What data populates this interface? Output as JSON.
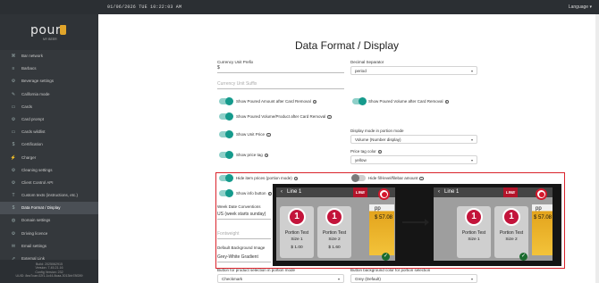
{
  "topbar": {
    "datetime": "01/06/2026 TUE     10:22:03 AM",
    "language": "Language"
  },
  "brand": {
    "name": "pour",
    "tagline": "MY BEER"
  },
  "sidebar": {
    "items": [
      {
        "label": "Bar network",
        "icon": "network-icon"
      },
      {
        "label": "Barbacs",
        "icon": "list-icon"
      },
      {
        "label": "Beverage settings",
        "icon": "gear-icon"
      },
      {
        "label": "California mode",
        "icon": "wrench-icon"
      },
      {
        "label": "Cards",
        "icon": "card-icon"
      },
      {
        "label": "Card prompt",
        "icon": "gear-icon"
      },
      {
        "label": "Cards wildlist",
        "icon": "card-icon"
      },
      {
        "label": "Certification",
        "icon": "dollar-icon"
      },
      {
        "label": "Charger",
        "icon": "plug-icon"
      },
      {
        "label": "Cleaning settings",
        "icon": "gear-icon"
      },
      {
        "label": "Client Control API",
        "icon": "gear-icon"
      },
      {
        "label": "Custom texts (instructions, etc.)",
        "icon": "text-icon"
      },
      {
        "label": "Data Format / Display",
        "icon": "dollar-icon"
      },
      {
        "label": "Domain settings",
        "icon": "globe-icon"
      },
      {
        "label": "Driving licence",
        "icon": "gear-icon"
      },
      {
        "label": "Email settings",
        "icon": "mail-icon"
      },
      {
        "label": "External Link",
        "icon": "link-icon"
      }
    ],
    "active_index": 12,
    "footer": [
      "Build: 2025062915",
      "Version: 7.45.21.16",
      "Config Version: 232",
      "UUID: 8ea7cae-02f1-1c44-8caa-3013bb78f289"
    ]
  },
  "page": {
    "title": "Data Format / Display",
    "currency_prefix_label": "Currency Unit Prefix",
    "currency_prefix_value": "$",
    "currency_suffix_placeholder": "Currency Unit Suffix",
    "decimal_separator_label": "Decimal Separator",
    "decimal_separator_value": "period",
    "display_mode_label": "Display mode in portion mode",
    "display_mode_value": "Volume (Number display)",
    "price_tag_color_label": "Price tag color",
    "price_tag_color_value": "yellow",
    "toggles": [
      "Show Poured Amount after Card Removal",
      "Show Poured Volume after Card Removal",
      "Show Poured Volume/Product after Card Removal",
      "Show Unit Price",
      "Show price tag",
      "Hide item prices (portion mode)",
      "Hide fill-level/filebar amount",
      "Show info button"
    ],
    "week_date_label": "Week Date Conventions",
    "week_date_value": "US (week starts sunday)",
    "unnamed_field_placeholder": "Fontweight",
    "bg_image_label": "Default Background Image",
    "bg_image_value": "Grey-White Gradient",
    "bottom_left_label": "Button for product selection in portion mode",
    "bottom_left_value": "Checkmark",
    "bottom_right_label": "Button background color for portion selection",
    "bottom_right_value": "Grey (Default)"
  },
  "preview": {
    "line_title": "Line 1",
    "logo_text": "LINE",
    "tiles": [
      {
        "number": "1",
        "name": "Portion Test",
        "size": "Size 1",
        "price": "$ 1.00"
      },
      {
        "number": "1",
        "name": "Portion Test",
        "size": "Size 2",
        "price": "$ 1.60"
      }
    ],
    "after_tiles": [
      {
        "number": "1",
        "name": "Portion Test",
        "size": "Size 1"
      },
      {
        "number": "1",
        "name": "Portion Test",
        "size": "Size 2"
      }
    ],
    "pp_label": "pp",
    "price": "$ 57.08",
    "check": "✓"
  }
}
